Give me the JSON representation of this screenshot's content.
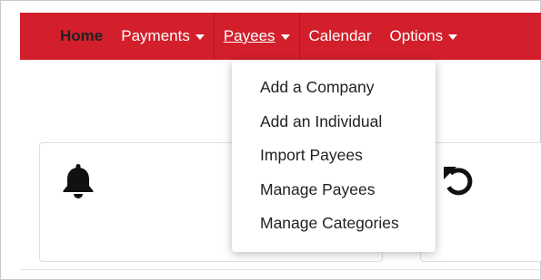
{
  "nav": {
    "home": "Home",
    "payments": "Payments",
    "payees": "Payees",
    "calendar": "Calendar",
    "options": "Options"
  },
  "payees_menu": {
    "items": [
      "Add a Company",
      "Add an Individual",
      "Import Payees",
      "Manage Payees",
      "Manage Categories"
    ]
  },
  "icons": {
    "notifications": "bell-icon",
    "history": "undo-icon"
  },
  "colors": {
    "navbar": "#d21f2b",
    "text": "#222222"
  }
}
